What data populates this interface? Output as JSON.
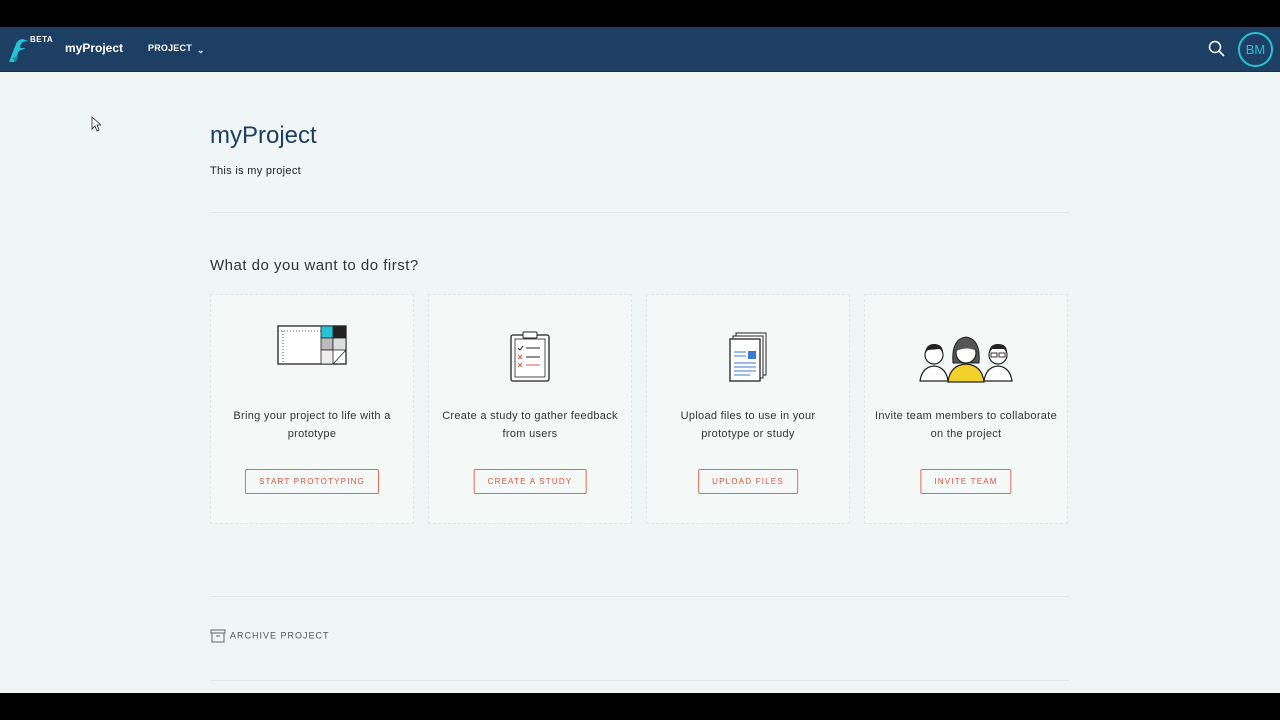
{
  "header": {
    "beta": "BETA",
    "project_name": "myProject",
    "project_menu": "PROJECT",
    "avatar_initials": "BM"
  },
  "main": {
    "title": "myProject",
    "description": "This is my project",
    "section_title": "What do you want to do first?",
    "cards": [
      {
        "text": "Bring your project to life with a prototype",
        "button": "START PROTOTYPING",
        "icon": "prototype-icon"
      },
      {
        "text": "Create a study to gather feedback from users",
        "button": "CREATE A STUDY",
        "icon": "clipboard-icon"
      },
      {
        "text": "Upload files to use in your prototype or study",
        "button": "UPLOAD FILES",
        "icon": "documents-icon"
      },
      {
        "text": "Invite team members to collaborate on the project",
        "button": "INVITE TEAM",
        "icon": "team-icon"
      }
    ],
    "archive_label": "ARCHIVE PROJECT"
  },
  "colors": {
    "header_bg": "#1d3f63",
    "accent_teal": "#26c3d4",
    "button_orange": "#e76a55",
    "page_bg": "#eff6f5"
  }
}
